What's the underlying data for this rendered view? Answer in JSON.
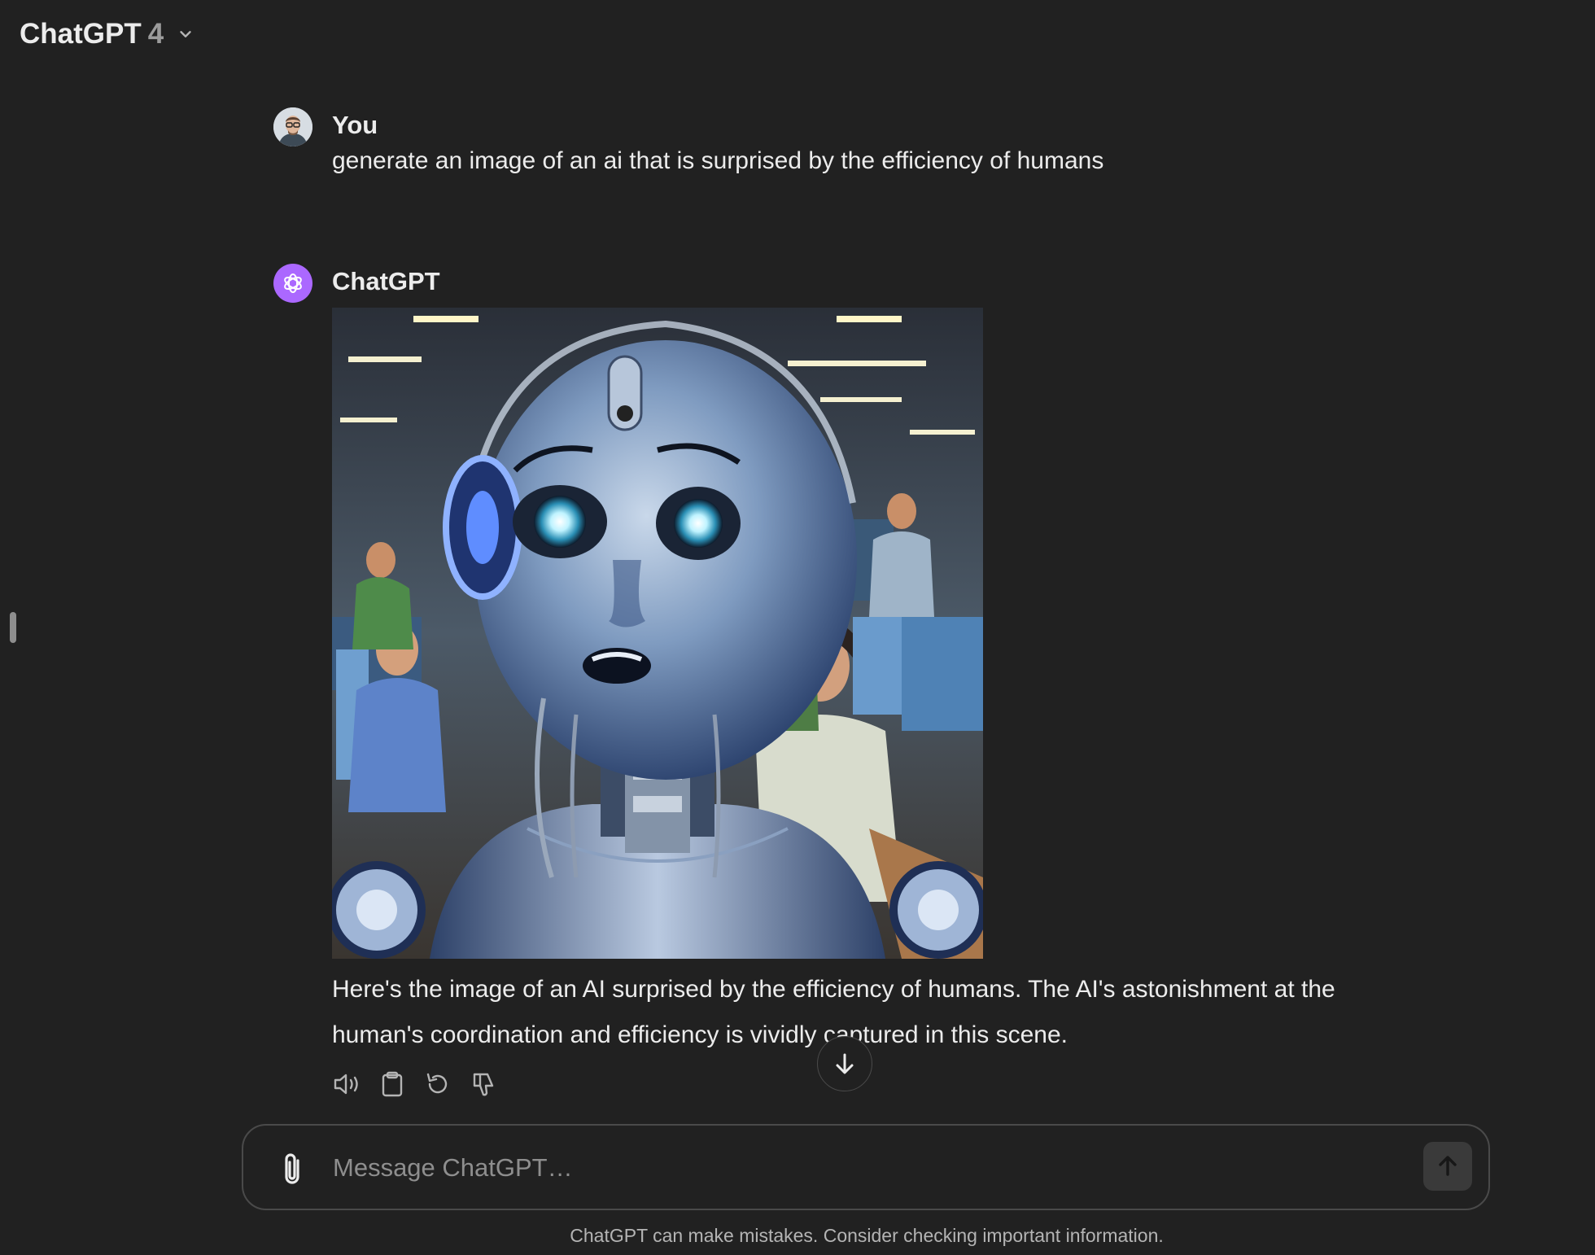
{
  "header": {
    "model_name": "ChatGPT",
    "model_version": "4",
    "menu_icon": "chevron-down-icon"
  },
  "conversation": {
    "user_message": {
      "author": "You",
      "text": "generate an image of an ai that is surprised by the efficiency of humans",
      "avatar_icon": "user-avatar"
    },
    "assistant_message": {
      "author": "ChatGPT",
      "avatar_icon": "openai-logo-icon",
      "avatar_color": "#ab68ff",
      "image": "generated image: surprised robot with blue eyes in an office of humans at computers",
      "text": "Here's the image of an AI surprised by the efficiency of humans. The AI's astonishment at the human's coordination and efficiency is vividly captured in this scene.",
      "actions": [
        "speaker-icon",
        "clipboard-icon",
        "regenerate-icon",
        "thumbs-down-icon"
      ]
    }
  },
  "composer": {
    "placeholder": "Message ChatGPT…",
    "attach_icon": "paperclip-icon",
    "send_icon": "arrow-up-icon"
  },
  "scroll_button_icon": "arrow-down-icon",
  "disclaimer": "ChatGPT can make mistakes. Consider checking important information."
}
